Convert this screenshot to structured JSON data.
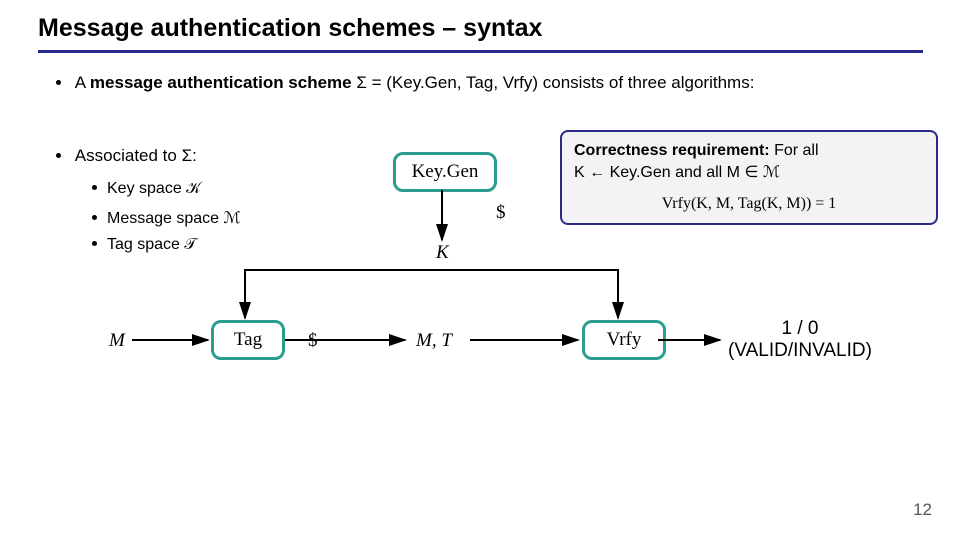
{
  "title": "Message authentication schemes – syntax",
  "bullets": {
    "b1_pre": "A ",
    "b1_bold": "message authentication scheme",
    "b1_post": " Σ = (Key.Gen, Tag, Vrfy) consists of three algorithms:",
    "b2_pre": "Associated to Σ:",
    "s1": "Key space 𝒦",
    "s2": "Message space ℳ",
    "s3": "Tag space 𝒯"
  },
  "boxes": {
    "keygen": "Key.Gen",
    "tag": "Tag",
    "vrfy": "Vrfy"
  },
  "labels": {
    "dollar1": "$",
    "K": "K",
    "M": "M",
    "dollar2": "$",
    "MT": "M, T",
    "out1": "1 / 0",
    "out2": "(VALID/INVALID)"
  },
  "correctness": {
    "bold": "Correctness requirement:",
    "line1": " For all",
    "line2": "K ← Key.Gen and all M ∈ ℳ",
    "eq": "Vrfy(K, M, Tag(K, M)) = 1"
  },
  "pagenum": "12"
}
